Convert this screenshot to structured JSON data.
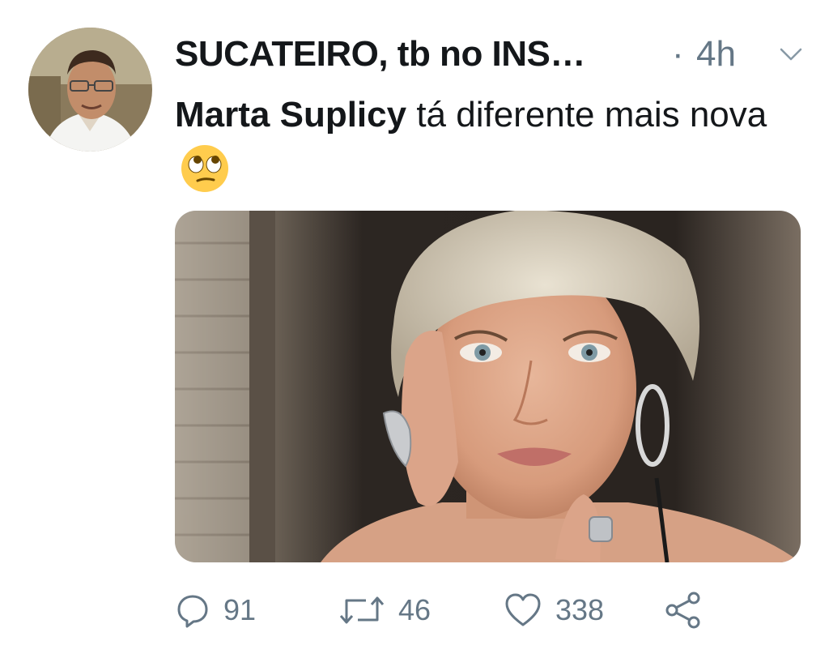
{
  "tweet": {
    "author": {
      "display_name": "SUCATEIRO, tb no INS…",
      "separator": "·",
      "timestamp": "4h",
      "avatar_icon": "avatar-photo"
    },
    "text": {
      "mention": "Marta Suplicy",
      "body": " tá diferente mais nova",
      "emoji": "face-with-rolling-eyes"
    },
    "media": {
      "type": "photo"
    },
    "actions": {
      "reply_count": "91",
      "retweet_count": "46",
      "like_count": "338"
    }
  },
  "colors": {
    "text_primary": "#14171a",
    "text_secondary": "#657786",
    "background": "#ffffff"
  }
}
